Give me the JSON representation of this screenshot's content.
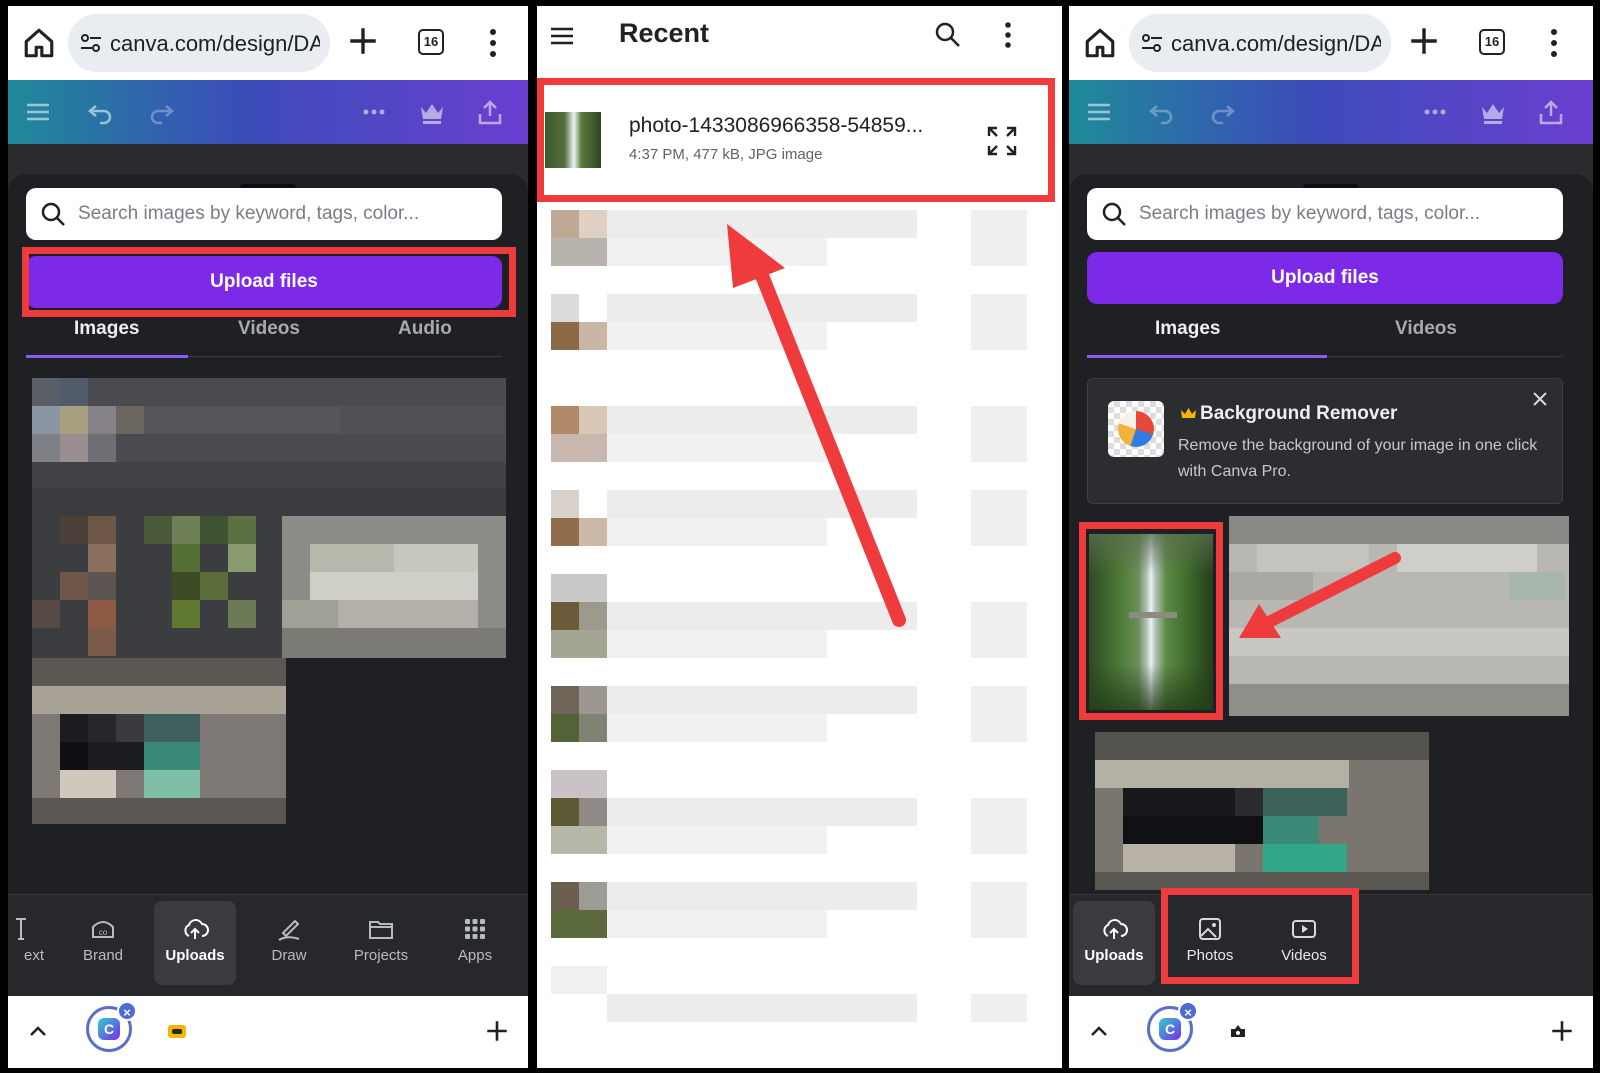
{
  "browser": {
    "url": "canva.com/design/DA",
    "tab_count": "16"
  },
  "editor": {
    "search_placeholder": "Search images by keyword, tags, color...",
    "upload_button": "Upload files",
    "tabs_left": [
      "Images",
      "Videos",
      "Audio"
    ],
    "tabs_right": [
      "Images",
      "Videos"
    ]
  },
  "nav_left": {
    "items": [
      {
        "label": "ext",
        "icon": "text-icon"
      },
      {
        "label": "Brand",
        "icon": "brand-icon"
      },
      {
        "label": "Uploads",
        "icon": "cloud-upload-icon"
      },
      {
        "label": "Draw",
        "icon": "pen-icon"
      },
      {
        "label": "Projects",
        "icon": "folder-icon"
      },
      {
        "label": "Apps",
        "icon": "grid-icon"
      }
    ]
  },
  "nav_right": {
    "items": [
      {
        "label": "Uploads",
        "icon": "cloud-upload-icon"
      },
      {
        "label": "Photos",
        "icon": "image-icon"
      },
      {
        "label": "Videos",
        "icon": "video-icon"
      }
    ]
  },
  "file_picker": {
    "title": "Recent",
    "file_name": "photo-1433086966358-54859...",
    "file_meta": "4:37 PM, 477 kB, JPG image"
  },
  "promo": {
    "title": "Background Remover",
    "description": "Remove the background of your image in one click with Canva Pro."
  },
  "colors": {
    "accent_purple": "#7d2ae8",
    "highlight_red": "#ef3b3b",
    "editor_bg": "#1f2023"
  }
}
